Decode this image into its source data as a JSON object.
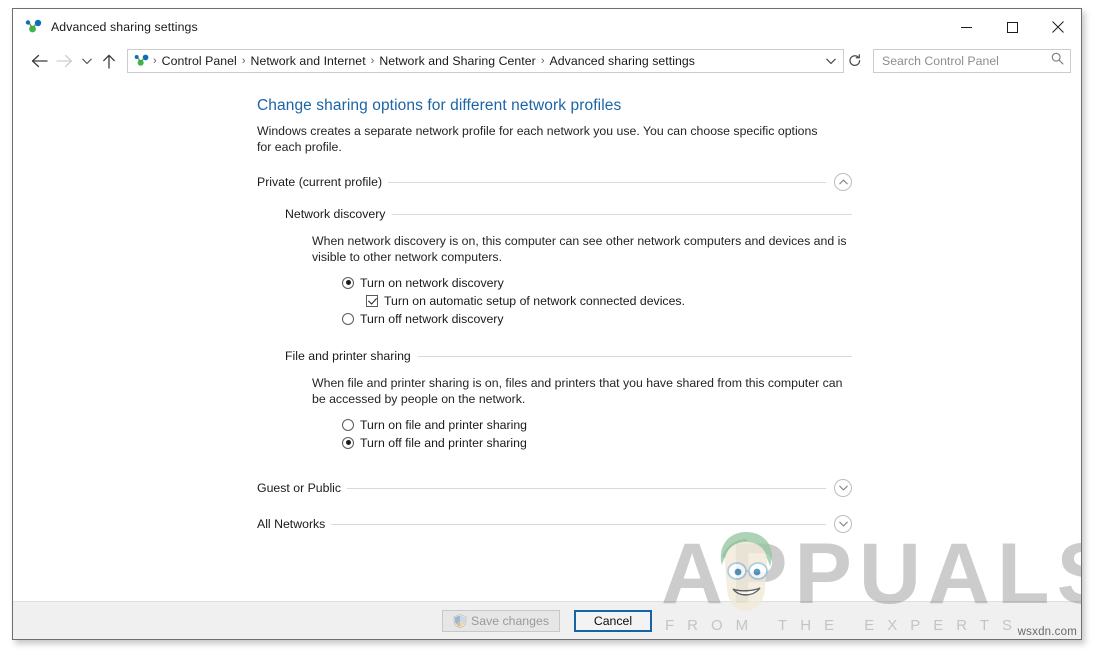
{
  "window": {
    "title": "Advanced sharing settings",
    "icon": "network-sharing-icon",
    "controls": {
      "minimize": "minimize-button",
      "maximize": "maximize-button",
      "close": "close-button"
    }
  },
  "navbar": {
    "back": "back-button",
    "forward": "forward-button",
    "recent": "recent-locations-button",
    "up": "up-button",
    "breadcrumbs": [
      "Control Panel",
      "Network and Internet",
      "Network and Sharing Center",
      "Advanced sharing settings"
    ],
    "separator": "›",
    "dropdown": "address-dropdown-button",
    "refresh": "refresh-button",
    "search": {
      "placeholder": "Search Control Panel",
      "value": "",
      "icon": "search-icon"
    }
  },
  "main": {
    "title": "Change sharing options for different network profiles",
    "description": "Windows creates a separate network profile for each network you use. You can choose specific options for each profile.",
    "profiles": [
      {
        "name": "Private (current profile)",
        "expanded": true,
        "expander_icon": "chevron-up-icon",
        "sections": [
          {
            "name": "Network discovery",
            "description": "When network discovery is on, this computer can see other network computers and devices and is visible to other network computers.",
            "options": [
              {
                "type": "radio",
                "label": "Turn on network discovery",
                "checked": true,
                "indent": false
              },
              {
                "type": "checkbox",
                "label": "Turn on automatic setup of network connected devices.",
                "checked": true,
                "indent": true
              },
              {
                "type": "radio",
                "label": "Turn off network discovery",
                "checked": false,
                "indent": false
              }
            ]
          },
          {
            "name": "File and printer sharing",
            "description": "When file and printer sharing is on, files and printers that you have shared from this computer can be accessed by people on the network.",
            "options": [
              {
                "type": "radio",
                "label": "Turn on file and printer sharing",
                "checked": false,
                "indent": false
              },
              {
                "type": "radio",
                "label": "Turn off file and printer sharing",
                "checked": true,
                "indent": false
              }
            ]
          }
        ]
      },
      {
        "name": "Guest or Public",
        "expanded": false,
        "expander_icon": "chevron-down-icon",
        "sections": []
      },
      {
        "name": "All Networks",
        "expanded": false,
        "expander_icon": "chevron-down-icon",
        "sections": []
      }
    ]
  },
  "commandbar": {
    "save": {
      "label": "Save changes",
      "disabled": true,
      "icon": "uac-shield-icon"
    },
    "cancel": {
      "label": "Cancel",
      "default": true
    }
  },
  "watermark": {
    "brand": "APPUALS",
    "tagline": "FROM THE EXPERTS",
    "site": "wsxdn.com",
    "mascot": "appuals-mascot-icon"
  },
  "colors": {
    "title_blue": "#1b64a5",
    "accent_focus": "#1564a8",
    "icon_green": "#3cb54a",
    "icon_blue": "#0f6cbd",
    "rule": "#d9d9d9",
    "commandbar_bg": "#f0f0f0"
  }
}
